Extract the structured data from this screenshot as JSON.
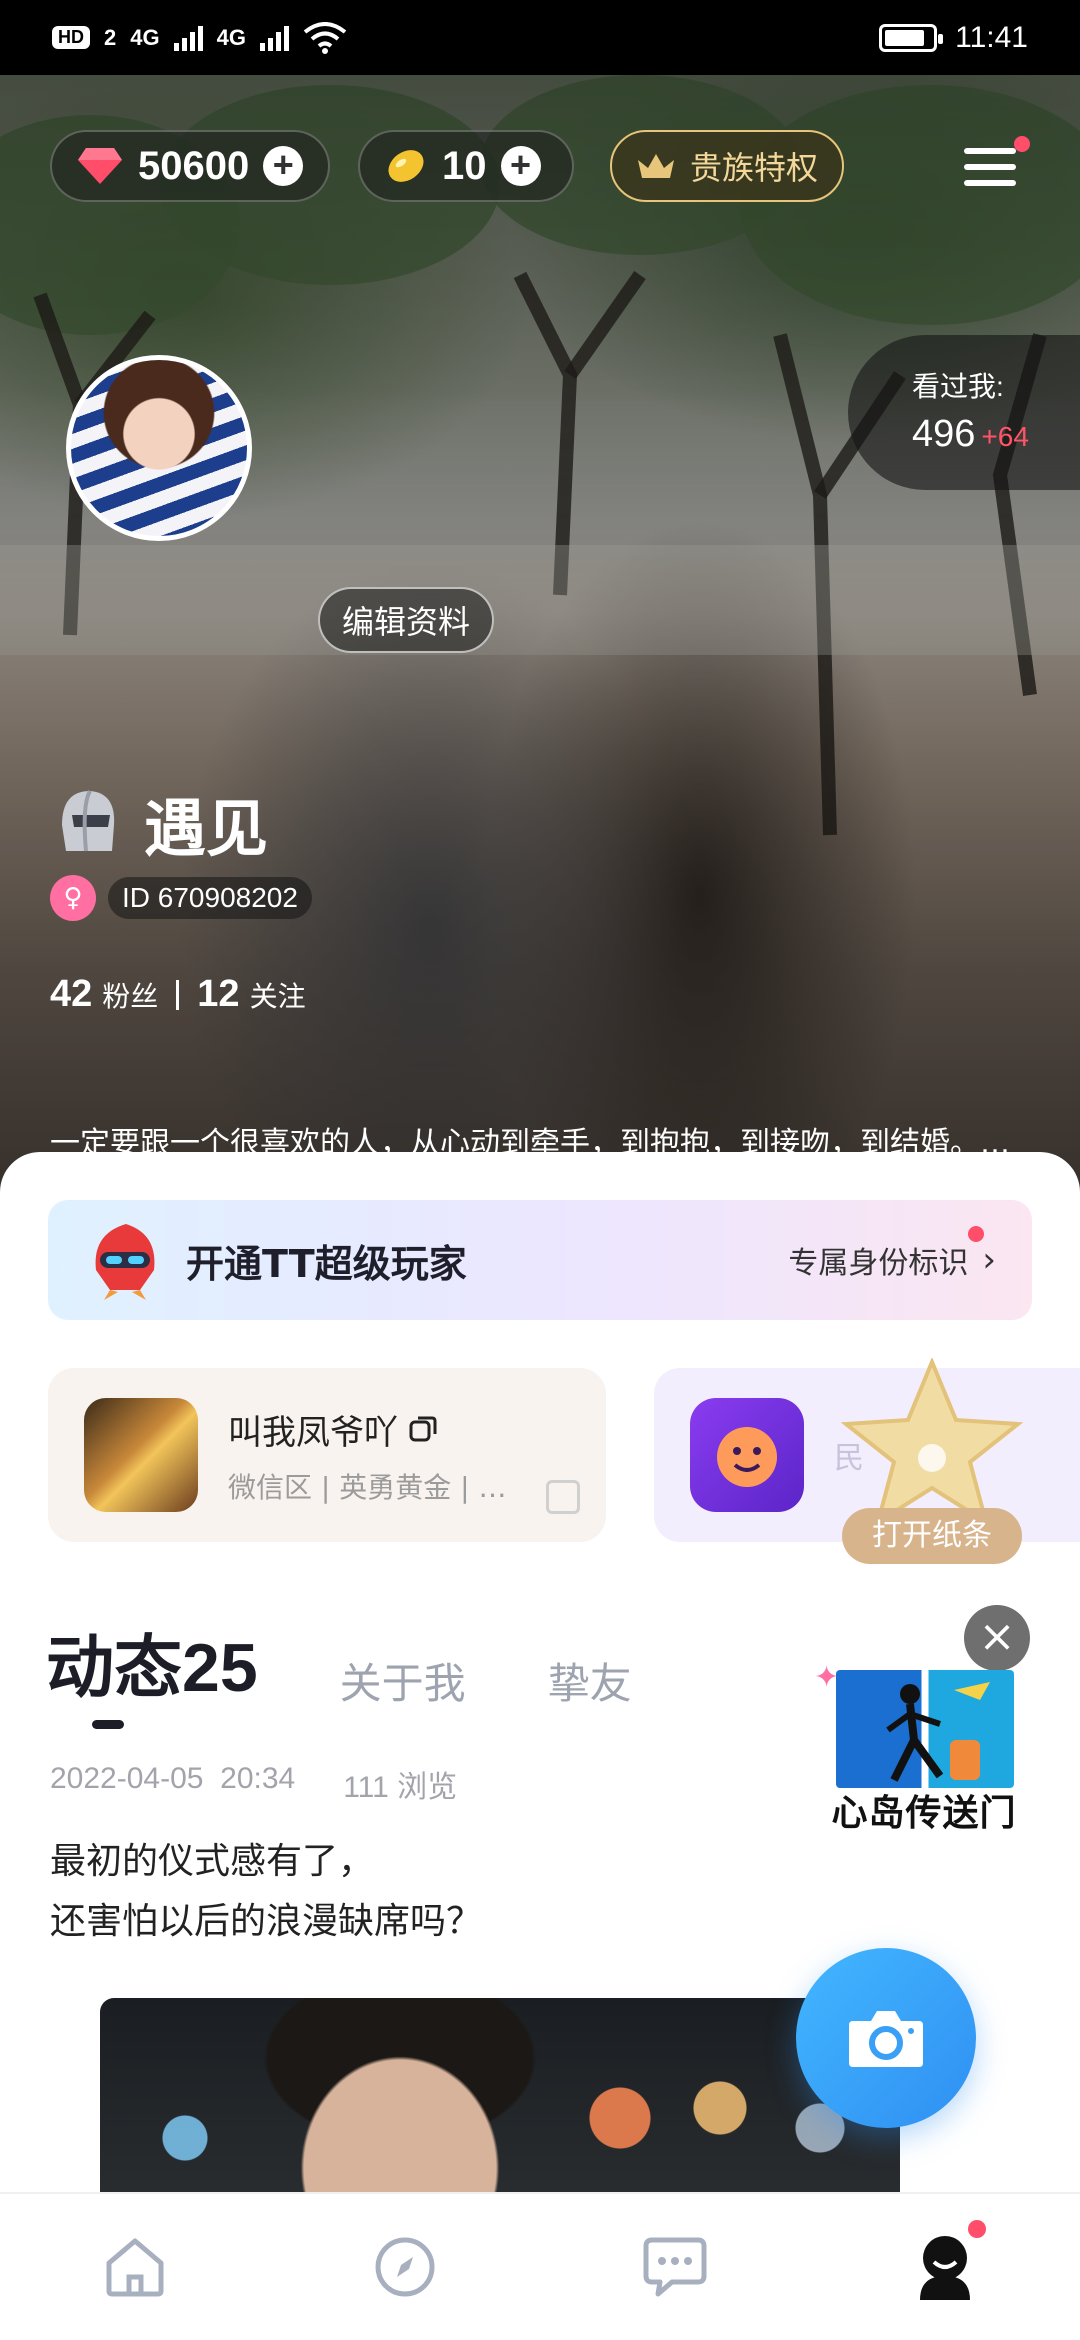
{
  "status_bar": {
    "left_badges": [
      "HD",
      "2",
      "4G",
      "4G"
    ],
    "time": "11:41",
    "battery_level": 0.85
  },
  "header": {
    "diamonds": "50600",
    "beans": "10",
    "noble_label": "贵族特权",
    "menu_has_badge": true
  },
  "visitors": {
    "label": "看过我:",
    "count": "496",
    "increase": "+64"
  },
  "profile": {
    "edit_label": "编辑资料",
    "name": "遇见",
    "id_text": "ID 670908202",
    "followers_count": "42",
    "followers_label": "粉丝",
    "following_count": "12",
    "following_label": "关注",
    "bio": "一定要跟一个很喜欢的人，从心动到牵手，到抱抱，到接吻，到结婚。…",
    "carousel_pages": 4,
    "carousel_active": 1
  },
  "vip_banner": {
    "title": "开通TT超级玩家",
    "subtitle": "专属身份标识",
    "arrow": "›"
  },
  "game_card": {
    "nickname": "叫我凤爷吖",
    "details": "微信区 | 英勇黄金 | …"
  },
  "second_card": {
    "label_partial": "民"
  },
  "tabs": [
    {
      "label": "动态",
      "count": "25",
      "active": true
    },
    {
      "label": "关于我",
      "active": false
    },
    {
      "label": "挚友",
      "active": false
    }
  ],
  "post": {
    "date": "2022-04-05",
    "time": "20:34",
    "views": "111 浏览",
    "text_line1": "最初的仪式感有了，",
    "text_line2": "还害怕以后的浪漫缺席吗？"
  },
  "floating": {
    "star_label": "打开纸条",
    "close_symbol": "×",
    "portal_label": "心岛传送门"
  },
  "nav": {
    "items": [
      "home",
      "discover",
      "messages",
      "me"
    ],
    "active": "me",
    "me_has_badge": true
  },
  "colors": {
    "accent_blue": "#2f8ff2",
    "badge_red": "#ff4d6a",
    "noble_gold": "#e7c57a",
    "gender_pink": "#ff6fa1"
  }
}
